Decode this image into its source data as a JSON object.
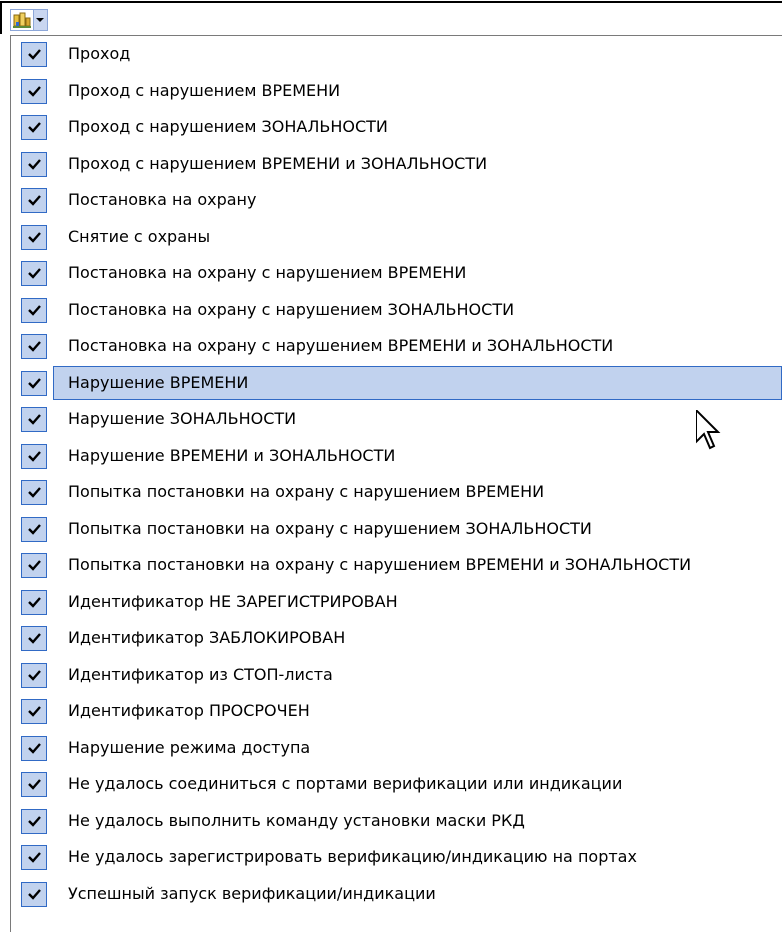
{
  "toolbar": {
    "main_icon": "event-filter-icon",
    "dropdown_icon": "chevron-down-icon"
  },
  "menu": {
    "check_icon": "checkmark-icon",
    "selected_index": 9,
    "items": [
      {
        "label": "Проход",
        "checked": true
      },
      {
        "label": "Проход с нарушением ВРЕМЕНИ",
        "checked": true
      },
      {
        "label": "Проход с нарушением ЗОНАЛЬНОСТИ",
        "checked": true
      },
      {
        "label": "Проход с нарушением ВРЕМЕНИ и ЗОНАЛЬНОСТИ",
        "checked": true
      },
      {
        "label": "Постановка на охрану",
        "checked": true
      },
      {
        "label": "Снятие с охраны",
        "checked": true
      },
      {
        "label": "Постановка на охрану с нарушением ВРЕМЕНИ",
        "checked": true
      },
      {
        "label": "Постановка на охрану с нарушением ЗОНАЛЬНОСТИ",
        "checked": true
      },
      {
        "label": "Постановка на охрану с нарушением ВРЕМЕНИ и ЗОНАЛЬНОСТИ",
        "checked": true
      },
      {
        "label": "Нарушение ВРЕМЕНИ",
        "checked": true
      },
      {
        "label": "Нарушение ЗОНАЛЬНОСТИ",
        "checked": true
      },
      {
        "label": "Нарушение ВРЕМЕНИ и ЗОНАЛЬНОСТИ",
        "checked": true
      },
      {
        "label": "Попытка постановки на охрану с нарушением ВРЕМЕНИ",
        "checked": true
      },
      {
        "label": "Попытка постановки на охрану с нарушением ЗОНАЛЬНОСТИ",
        "checked": true
      },
      {
        "label": "Попытка постановки на охрану с нарушением ВРЕМЕНИ и ЗОНАЛЬНОСТИ",
        "checked": true
      },
      {
        "label": "Идентификатор НЕ ЗАРЕГИСТРИРОВАН",
        "checked": true
      },
      {
        "label": "Идентификатор ЗАБЛОКИРОВАН",
        "checked": true
      },
      {
        "label": "Идентификатор из СТОП-листа",
        "checked": true
      },
      {
        "label": "Идентификатор ПРОСРОЧЕН",
        "checked": true
      },
      {
        "label": "Нарушение режима доступа",
        "checked": true
      },
      {
        "label": "Не удалось соединиться с портами верификации или индикации",
        "checked": true
      },
      {
        "label": "Не удалось выполнить команду установки маски РКД",
        "checked": true
      },
      {
        "label": "Не удалось зарегистрировать верификацию/индикацию на портах",
        "checked": true
      },
      {
        "label": "Успешный запуск верификации/индикации",
        "checked": true
      }
    ]
  },
  "colors": {
    "highlight": "#c1d2ee",
    "highlight_border": "#316ac5"
  }
}
